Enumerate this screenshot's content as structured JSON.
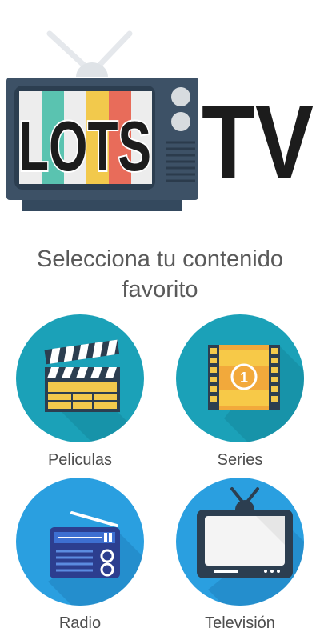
{
  "logo": {
    "tv_text": "LOTS",
    "brand_text": "TV"
  },
  "prompt": {
    "line1": "Selecciona tu contenido",
    "line2": "favorito"
  },
  "categories": [
    {
      "label": "Peliculas",
      "icon": "clapperboard-icon",
      "bg": "#1ba1b8"
    },
    {
      "label": "Series",
      "icon": "film-strip-icon",
      "bg": "#1ba1b8"
    },
    {
      "label": "Radio",
      "icon": "radio-icon",
      "bg": "#2a9fe0"
    },
    {
      "label": "Televisión",
      "icon": "television-icon",
      "bg": "#2a9fe0"
    }
  ]
}
